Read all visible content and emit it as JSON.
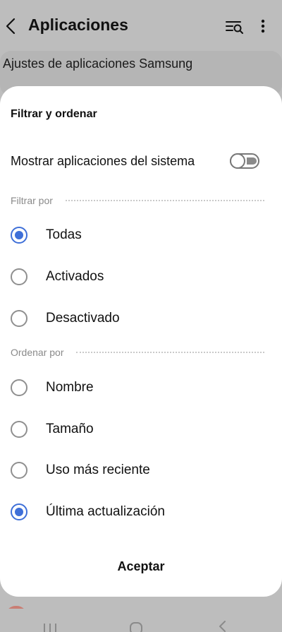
{
  "app_bar": {
    "title": "Aplicaciones",
    "back_icon": "back-chevron-icon",
    "filter_icon": "filter-search-icon",
    "more_icon": "more-vertical-icon"
  },
  "background_card": {
    "label": "Ajustes de aplicaciones Samsung"
  },
  "sheet": {
    "title": "Filtrar y ordenar",
    "system_toggle": {
      "label": "Mostrar aplicaciones del sistema",
      "checked": false
    },
    "filter_section": {
      "header": "Filtrar por",
      "options": [
        {
          "label": "Todas",
          "checked": true
        },
        {
          "label": "Activados",
          "checked": false
        },
        {
          "label": "Desactivado",
          "checked": false
        }
      ]
    },
    "sort_section": {
      "header": "Ordenar por",
      "options": [
        {
          "label": "Nombre",
          "checked": false
        },
        {
          "label": "Tamaño",
          "checked": false
        },
        {
          "label": "Uso más reciente",
          "checked": false
        },
        {
          "label": "Última actualización",
          "checked": true
        }
      ]
    },
    "accept_label": "Aceptar"
  },
  "colors": {
    "accent": "#3e6fd8",
    "scrim": "#bdbdbd",
    "sheet": "#ffffff"
  }
}
